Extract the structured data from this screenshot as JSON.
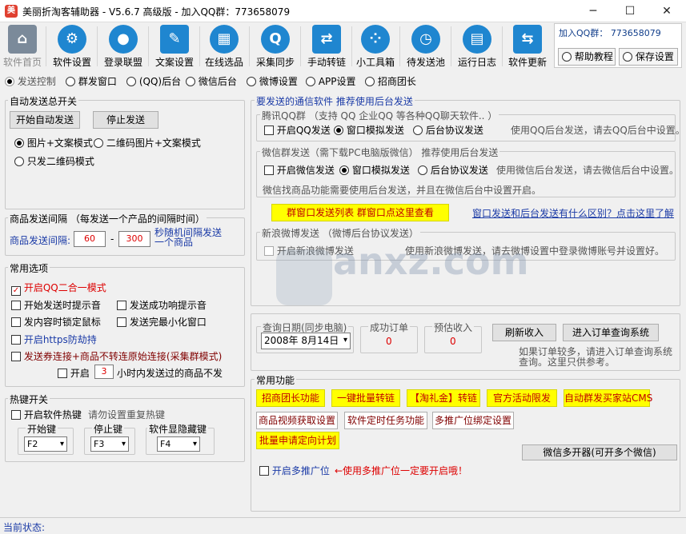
{
  "window": {
    "title": "美丽折淘客辅助器 - V5.6.7 高级版 - 加入QQ群：773658079",
    "app_icon": "app-icon",
    "minimize": "─",
    "maximize": "☐",
    "close": "✕"
  },
  "toolbar": [
    {
      "label": "软件首页",
      "icon": "home-icon",
      "glyph": "⌂"
    },
    {
      "label": "软件设置",
      "icon": "gear-icon",
      "glyph": "⚙"
    },
    {
      "label": "登录联盟",
      "icon": "user-icon",
      "glyph": "●"
    },
    {
      "label": "文案设置",
      "icon": "document-icon",
      "glyph": "✎"
    },
    {
      "label": "在线选品",
      "icon": "shop-icon",
      "glyph": "▦"
    },
    {
      "label": "采集同步",
      "icon": "qq-icon",
      "glyph": "Q"
    },
    {
      "label": "手动转链",
      "icon": "transfer-icon",
      "glyph": "⇄"
    },
    {
      "label": "小工具箱",
      "icon": "toolbox-icon",
      "glyph": "⁘"
    },
    {
      "label": "待发送池",
      "icon": "clock-icon",
      "glyph": "◷"
    },
    {
      "label": "运行日志",
      "icon": "log-icon",
      "glyph": "▤"
    },
    {
      "label": "软件更新",
      "icon": "update-icon",
      "glyph": "⇆"
    }
  ],
  "qqbox": {
    "title": "加入QQ群：  773658079",
    "help": "帮助教程",
    "save": "保存设置"
  },
  "tabs": [
    "发送控制",
    "群发窗口",
    "(QQ)后台",
    "微信后台",
    "微博设置",
    "APP设置",
    "招商团长"
  ],
  "auto": {
    "title": "自动发送总开关",
    "start": "开始自动发送",
    "stop": "停止发送",
    "mode1": "图片+文案模式",
    "mode2": "二维码图片+文案模式",
    "mode3": "只发二维码模式"
  },
  "interval": {
    "title": "商品发送间隔  （每发送一个产品的间隔时间）",
    "label": "商品发送间隔:",
    "min": "60",
    "dash": "-",
    "max": "300",
    "note1": "秒随机间隔发送",
    "note2": "一个商品"
  },
  "common": {
    "title": "常用选项",
    "opt1": "开启QQ二合一模式",
    "opt2": "开始发送时提示音",
    "opt3": "发送成功响提示音",
    "opt4": "发内容时锁定鼠标",
    "opt5": "发送完最小化窗口",
    "opt6": "开启https防劫持",
    "opt7": "发送券连接+商品不转连原始连接(采集群模式)",
    "opt8_pre": "开启",
    "opt8_val": "3",
    "opt8_post": "小时内发送过的商品不发"
  },
  "hotkey": {
    "title": "热键开关",
    "enable": "开启软件热键",
    "note": "请勿设置重复热键",
    "start_label": "开始键",
    "start_val": "F2",
    "stop_label": "停止键",
    "stop_val": "F3",
    "hide_label": "软件显隐藏键",
    "hide_val": "F4"
  },
  "comm": {
    "title": "要发送的通信软件    推荐使用后台发送",
    "qq_title": "腾讯QQ群 （支持 QQ 企业QQ 等各种QQ聊天软件.. ）",
    "qq_enable": "开启QQ发送",
    "qq_win": "窗口模拟发送",
    "qq_bg": "后台协议发送",
    "qq_note": "使用QQ后台发送，请去QQ后台中设置。",
    "wx_title": "微信群发送（需下载PC电脑版微信） 推荐使用后台发送",
    "wx_enable": "开启微信发送",
    "wx_win": "窗口模拟发送",
    "wx_bg": "后台协议发送",
    "wx_note": "使用微信后台发送，请去微信后台中设置。",
    "wx_note2": "微信找商品功能需要使用后台发送，并且在微信后台中设置开启。",
    "group_btn": "群窗口发送列表  群窗口点这里查看",
    "diff_link": "窗口发送和后台发送有什么区别？点击这里了解",
    "wb_title": "新浪微博发送  （微博后台协议发送）",
    "wb_enable": "开启新浪微博发送",
    "wb_note": "使用新浪微博发送，请去微博设置中登录微博账号并设置好。"
  },
  "query": {
    "date_title": "查询日期(同步电脑)",
    "date": "2008年  8月14日",
    "orders_title": "成功订单",
    "orders": "0",
    "income_title": "预估收入",
    "income": "0",
    "refresh": "刷新收入",
    "enter": "进入订单查询系统",
    "note1": "如果订单较多，请进入订单查询系统",
    "note2": "查询。这里只供参考。"
  },
  "func": {
    "title": "常用功能",
    "b1": "招商团长功能",
    "b2": "一键批量转链",
    "b3": "【淘礼金】转链",
    "b4": "官方活动限发",
    "b5": "自动群发买家站CMS",
    "b6": "商品视频获取设置",
    "b7": "软件定时任务功能",
    "b8": "多推广位绑定设置",
    "b9": "批量申请定向计划",
    "wx_multi": "微信多开器(可开多个微信)",
    "multi_pid": "开启多推广位",
    "multi_note": "←使用多推广位一定要开启哦！"
  },
  "status": {
    "label": "当前状态:"
  },
  "watermark": "anxz.com"
}
